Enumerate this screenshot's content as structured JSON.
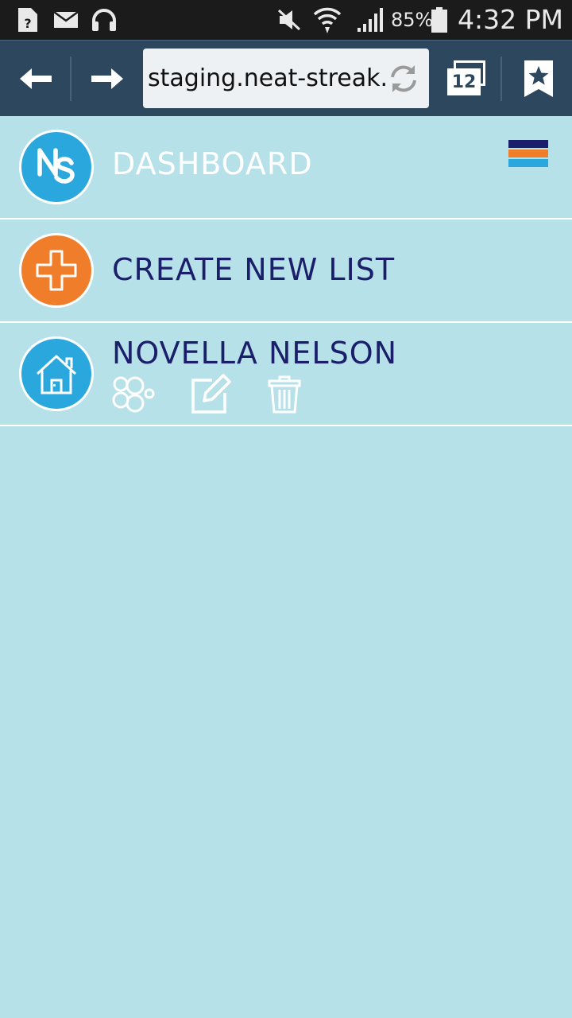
{
  "status_bar": {
    "battery": "85%",
    "time": "4:32 PM",
    "icons": [
      "unknown-file-icon",
      "mail-icon",
      "headphones-icon",
      "mute-icon",
      "wifi-icon",
      "signal-icon",
      "battery-icon"
    ]
  },
  "browser": {
    "url": "staging.neat-streak.c",
    "tab_count": "12",
    "icons": [
      "back-arrow-icon",
      "forward-arrow-icon",
      "reload-icon",
      "tabs-icon",
      "bookmark-icon"
    ]
  },
  "menu": {
    "dashboard": {
      "label": "DASHBOARD",
      "logo_text": "NS",
      "icon": "ns-logo"
    },
    "create": {
      "label": "CREATE NEW LIST",
      "icon": "plus-icon"
    },
    "list": {
      "label": "NOVELLA NELSON",
      "icon": "house-icon",
      "actions": [
        "bubbles-icon",
        "edit-icon",
        "trash-icon"
      ]
    }
  },
  "colors": {
    "page_bg": "#b7e1e8",
    "status_bar": "#1b1b1b",
    "browser_bar": "#2d475f",
    "accent_blue": "#2aa8dd",
    "accent_orange": "#f07d2a",
    "navy": "#1b1f6b"
  }
}
